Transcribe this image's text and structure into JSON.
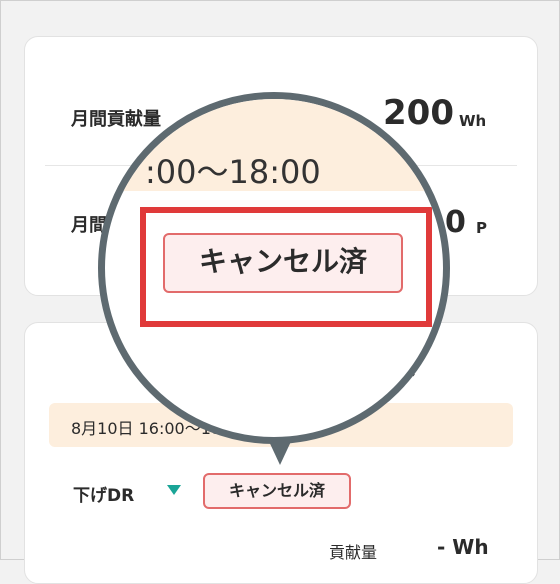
{
  "card1": {
    "monthly_contribution_label": "月間貢献量",
    "monthly_contribution_value": "200",
    "monthly_contribution_unit": "Wh",
    "monthly_points_label": "月間",
    "monthly_points_value": "0",
    "monthly_points_unit": "P"
  },
  "card2": {
    "right_label": "貢献",
    "event_time": "8月10日 16:00〜18:00",
    "event_type": "下げDR",
    "status_badge": "キャンセル済",
    "contribution_label": "貢献量",
    "contribution_value": "- Wh"
  },
  "magnifier": {
    "time_text": ":00〜18:00",
    "status_badge": "キャンセル済"
  },
  "colors": {
    "accent_red": "#e03a3a",
    "badge_border": "#e26b6b",
    "badge_bg": "#fdeeee",
    "peach": "#fdeedd",
    "teal": "#1aa597",
    "magnifier_ring": "#5e6a70"
  }
}
